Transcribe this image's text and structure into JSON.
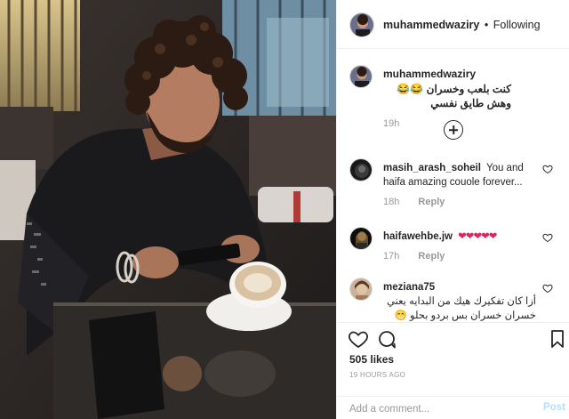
{
  "post": {
    "username": "muhammedwaziry",
    "separator": "•",
    "follow_status": "Following",
    "photo_alt": "Man with curly hair using phone at cafe table"
  },
  "caption": {
    "username": "muhammedwaziry",
    "text": "كنت بلعب وخسران 😂😂 وهش طايق نفسي",
    "time": "19h"
  },
  "comments": [
    {
      "username": "masih_arash_soheil",
      "text": "You and haifa amazing couole forever...",
      "time": "18h",
      "reply": "Reply"
    },
    {
      "username": "haifawehbe.jw",
      "text": "❤❤❤❤❤",
      "time": "17h",
      "reply": "Reply"
    },
    {
      "username": "meziana75",
      "text": "أزا كان تفكيرك هيك من البدايه يعني خسران خسران بس بردو بحلو 😁😁"
    }
  ],
  "actions": {
    "likes": "505 likes",
    "timestamp": "19 HOURS AGO",
    "comment_placeholder": "Add a comment...",
    "post_label": "Post"
  },
  "colors": {
    "border": "#efefef",
    "muted": "#999999",
    "text": "#262626",
    "post_disabled": "#b2dffc",
    "heart_red": "#e0245e"
  }
}
